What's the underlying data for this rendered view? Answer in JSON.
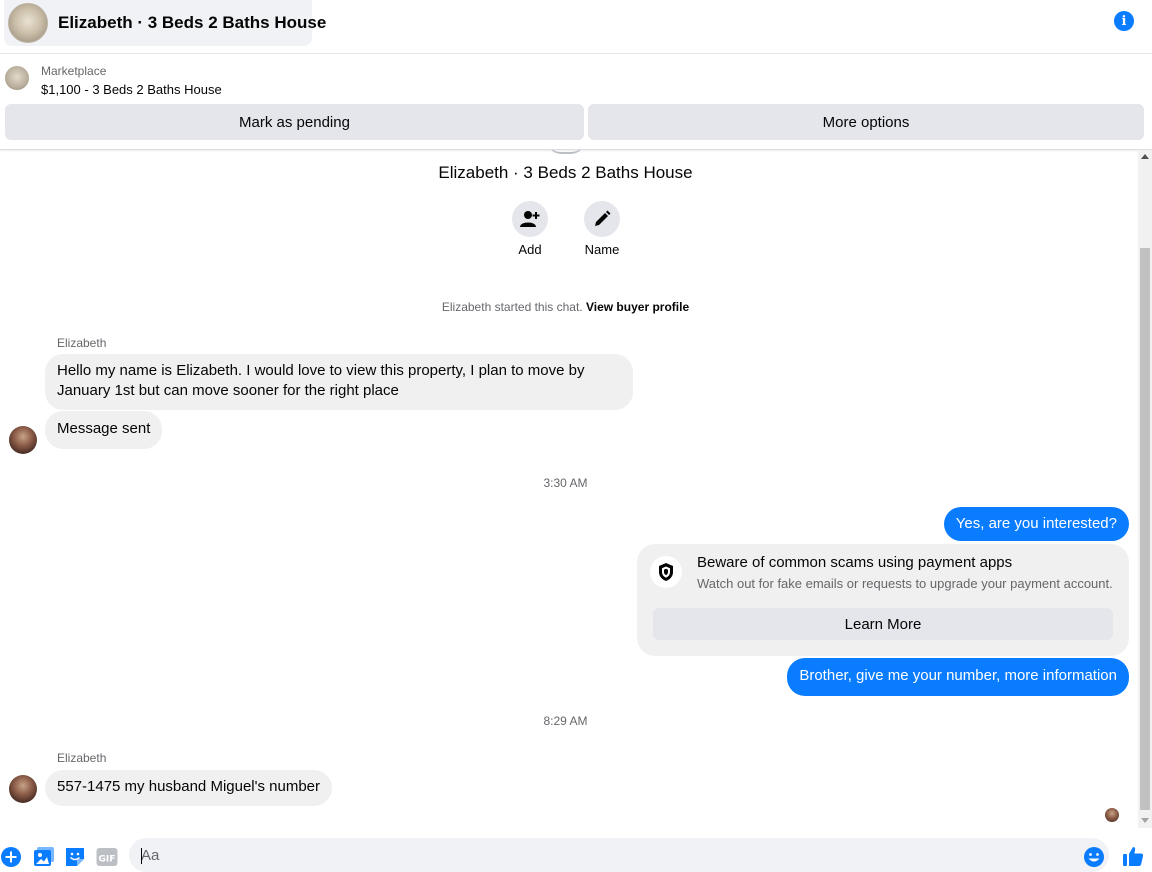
{
  "header": {
    "title": "Elizabeth · 3 Beds 2 Baths House",
    "info_icon": "i"
  },
  "listing": {
    "label": "Marketplace",
    "price_title": "$1,100 - 3 Beds 2 Baths House",
    "mark_pending": "Mark as pending",
    "more_options": "More options"
  },
  "chat": {
    "title": "Elizabeth · 3 Beds 2 Baths House",
    "add_label": "Add",
    "name_label": "Name",
    "system_text": "Elizabeth started this chat.",
    "system_link": "View buyer profile",
    "sender_1": "Elizabeth",
    "msg_1": "Hello my name is Elizabeth. I would love to view this property, I plan to move by January 1st but can move sooner for the right place",
    "msg_2": "Message sent",
    "time_1": "3:30 AM",
    "out_1": "Yes, are you interested?",
    "scam_title": "Beware of common scams using payment apps",
    "scam_sub": "Watch out for fake emails or requests to upgrade your payment account.",
    "learn_more": "Learn More",
    "out_2": "Brother, give me your number, more information",
    "time_2": "8:29 AM",
    "sender_2": "Elizabeth",
    "msg_3": "557-1475 my husband Miguel's number"
  },
  "composer": {
    "placeholder": "Aa",
    "gif_label": "GIF"
  },
  "colors": {
    "accent": "#0a7cff",
    "bubble_in": "#f0f0f0",
    "button_bg": "#e4e6eb",
    "secondary_text": "#65676b"
  }
}
